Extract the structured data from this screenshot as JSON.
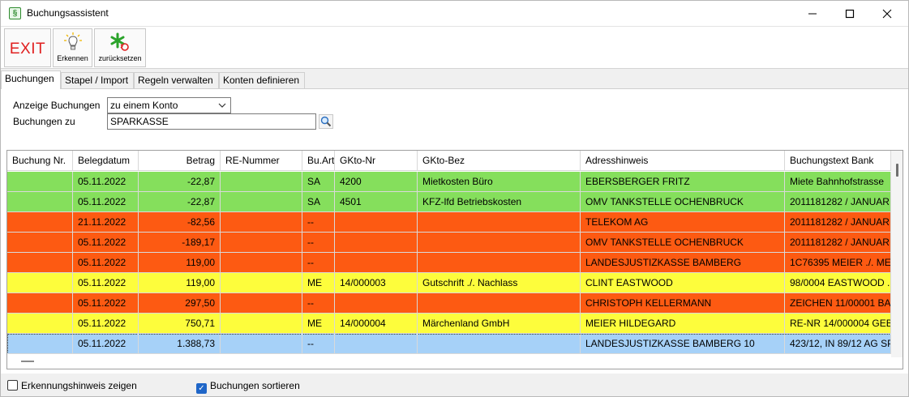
{
  "window": {
    "title": "Buchungsassistent",
    "app_icon": "§"
  },
  "toolbar": {
    "exit_label": "EXIT",
    "erkennen_label": "Erkennen",
    "reset_label": "zurücksetzen"
  },
  "tabs": [
    {
      "label": "Buchungen"
    },
    {
      "label": "Stapel / Import"
    },
    {
      "label": "Regeln verwalten"
    },
    {
      "label": "Konten definieren"
    }
  ],
  "filter": {
    "anzeige_label": "Anzeige Buchungen",
    "anzeige_value": "zu einem Konto",
    "buchungen_zu_label": "Buchungen zu",
    "buchungen_zu_value": "SPARKASSE"
  },
  "table": {
    "columns": [
      "Buchung Nr.",
      "Belegdatum",
      "Betrag",
      "RE-Nummer",
      "Bu.Art",
      "GKto-Nr",
      "GKto-Bez",
      "Adresshinweis",
      "Buchungstext Bank"
    ],
    "rows": [
      {
        "color": "#85df5c",
        "cells": [
          "",
          "05.11.2022",
          "-22,87",
          "",
          "SA",
          "4200",
          "Mietkosten Büro",
          "EBERSBERGER FRITZ",
          "Miete Bahnhofstrasse"
        ]
      },
      {
        "color": "#85df5c",
        "cells": [
          "",
          "05.11.2022",
          "-22,87",
          "",
          "SA",
          "4501",
          "KFZ-lfd Betriebskosten",
          "OMV TANKSTELLE OCHENBRUCK",
          "2011181282 / JANUAR"
        ]
      },
      {
        "color": "#fd5a12",
        "cells": [
          "",
          "21.11.2022",
          "-82,56",
          "",
          "--",
          "",
          "",
          "TELEKOM AG",
          "2011181282 / JANUAR"
        ]
      },
      {
        "color": "#fd5a12",
        "cells": [
          "",
          "05.11.2022",
          "-189,17",
          "",
          "--",
          "",
          "",
          "OMV TANKSTELLE OCHENBRUCK",
          "2011181282 / JANUAR"
        ]
      },
      {
        "color": "#fd5a12",
        "cells": [
          "",
          "05.11.2022",
          "119,00",
          "",
          "--",
          "",
          "",
          "LANDESJUSTIZKASSE BAMBERG",
          "1C76395 MEIER ./. ME"
        ]
      },
      {
        "color": "#fdfd3c",
        "cells": [
          "",
          "05.11.2022",
          "119,00",
          "",
          "ME",
          "14/000003",
          "Gutschrift ./. Nachlass",
          "CLINT EASTWOOD",
          "98/0004 EASTWOOD ."
        ]
      },
      {
        "color": "#fd5a12",
        "cells": [
          "",
          "05.11.2022",
          "297,50",
          "",
          "--",
          "",
          "",
          "CHRISTOPH KELLERMANN",
          "ZEICHEN 11/00001 BA"
        ]
      },
      {
        "color": "#fdfd3c",
        "cells": [
          "",
          "05.11.2022",
          "750,71",
          "",
          "ME",
          "14/000004",
          "Märchenland GmbH",
          "MEIER HILDEGARD",
          "RE-NR 14/000004 GEB"
        ]
      },
      {
        "color": "#a6d1f8",
        "selected": true,
        "cells": [
          "",
          "05.11.2022",
          "1.388,73",
          "",
          "--",
          "",
          "",
          "LANDESJUSTIZKASSE BAMBERG 10",
          "423/12, IN 89/12 AG SP"
        ]
      }
    ]
  },
  "bottom": {
    "erkennungshinweis_label": "Erkennungshinweis zeigen",
    "erkennungshinweis_checked": false,
    "sortieren_label": "Buchungen sortieren",
    "sortieren_checked": true
  }
}
